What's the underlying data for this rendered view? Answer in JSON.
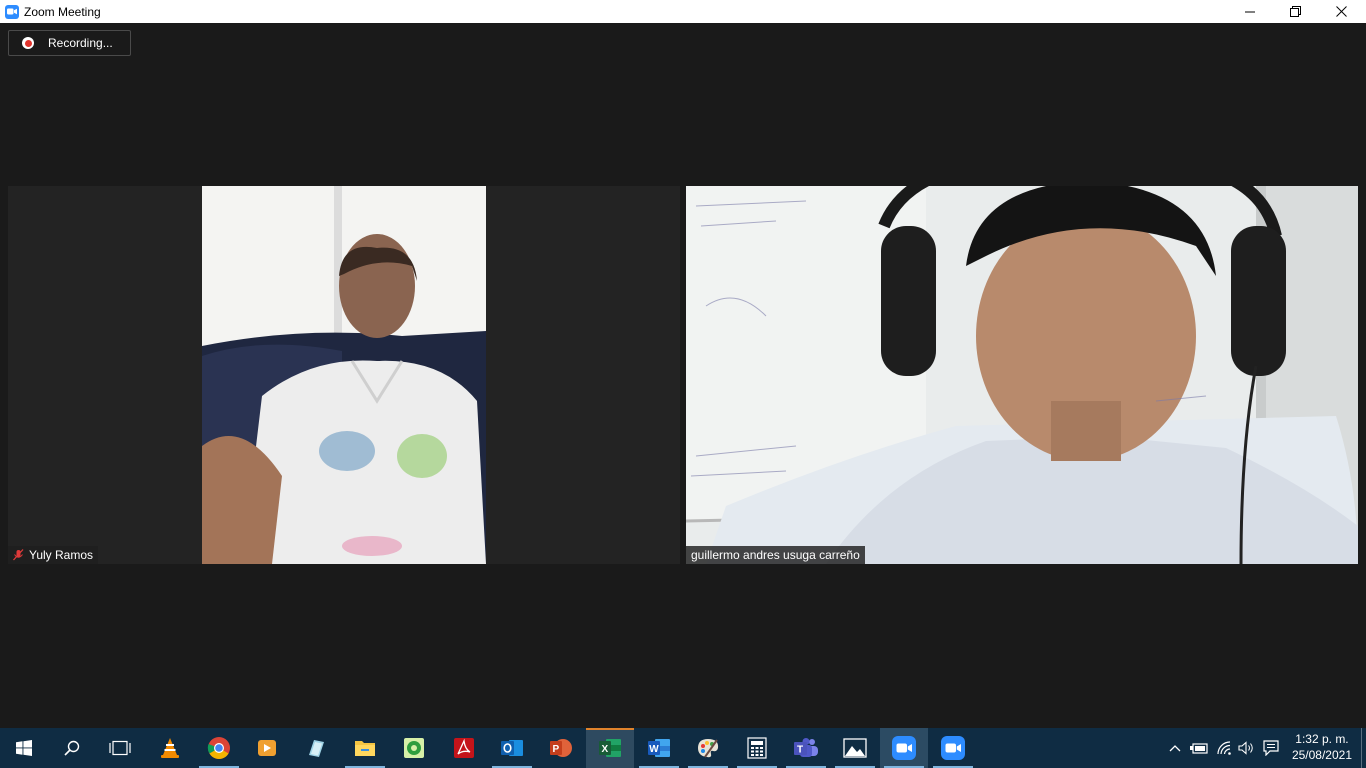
{
  "window": {
    "title": "Zoom Meeting",
    "app_icon": "zoom-camera-icon",
    "controls": [
      "minimize-icon",
      "restore-icon",
      "close-icon"
    ]
  },
  "recording": {
    "label": "Recording..."
  },
  "participants": [
    {
      "name": "Yuly Ramos",
      "muted": true
    },
    {
      "name": "guillermo andres usuga carreño",
      "muted": false
    }
  ],
  "taskbar": {
    "apps": [
      {
        "name": "start",
        "icon": "windows-logo-icon"
      },
      {
        "name": "search",
        "icon": "search-icon"
      },
      {
        "name": "task-view",
        "icon": "task-view-icon"
      },
      {
        "name": "vlc",
        "icon": "vlc-cone-icon"
      },
      {
        "name": "chrome",
        "icon": "chrome-icon"
      },
      {
        "name": "media-player",
        "icon": "media-player-icon"
      },
      {
        "name": "notes",
        "icon": "notes-icon"
      },
      {
        "name": "file-explorer",
        "icon": "folder-icon"
      },
      {
        "name": "green-app",
        "icon": "green-app-icon"
      },
      {
        "name": "acrobat",
        "icon": "pdf-icon"
      },
      {
        "name": "outlook",
        "icon": "outlook-icon"
      },
      {
        "name": "powerpoint",
        "icon": "powerpoint-icon"
      },
      {
        "name": "excel",
        "icon": "excel-icon"
      },
      {
        "name": "word",
        "icon": "word-icon"
      },
      {
        "name": "paint",
        "icon": "paint-palette-icon"
      },
      {
        "name": "calculator",
        "icon": "calculator-icon"
      },
      {
        "name": "teams",
        "icon": "teams-icon"
      },
      {
        "name": "photos",
        "icon": "photos-icon"
      },
      {
        "name": "zoom",
        "icon": "zoom-icon"
      },
      {
        "name": "zoom-meeting",
        "icon": "zoom-icon"
      }
    ],
    "tray": [
      "chevron-up-icon",
      "battery-icon",
      "wifi-icon",
      "volume-icon",
      "notification-icon"
    ],
    "clock": {
      "time": "1:32 p. m.",
      "date": "25/08/2021"
    }
  },
  "colors": {
    "background": "#1a1a1a",
    "tile": "#232323",
    "taskbar": "#0f2c43",
    "zoom_blue": "#2d8cff",
    "recording_red": "#e0332c"
  }
}
